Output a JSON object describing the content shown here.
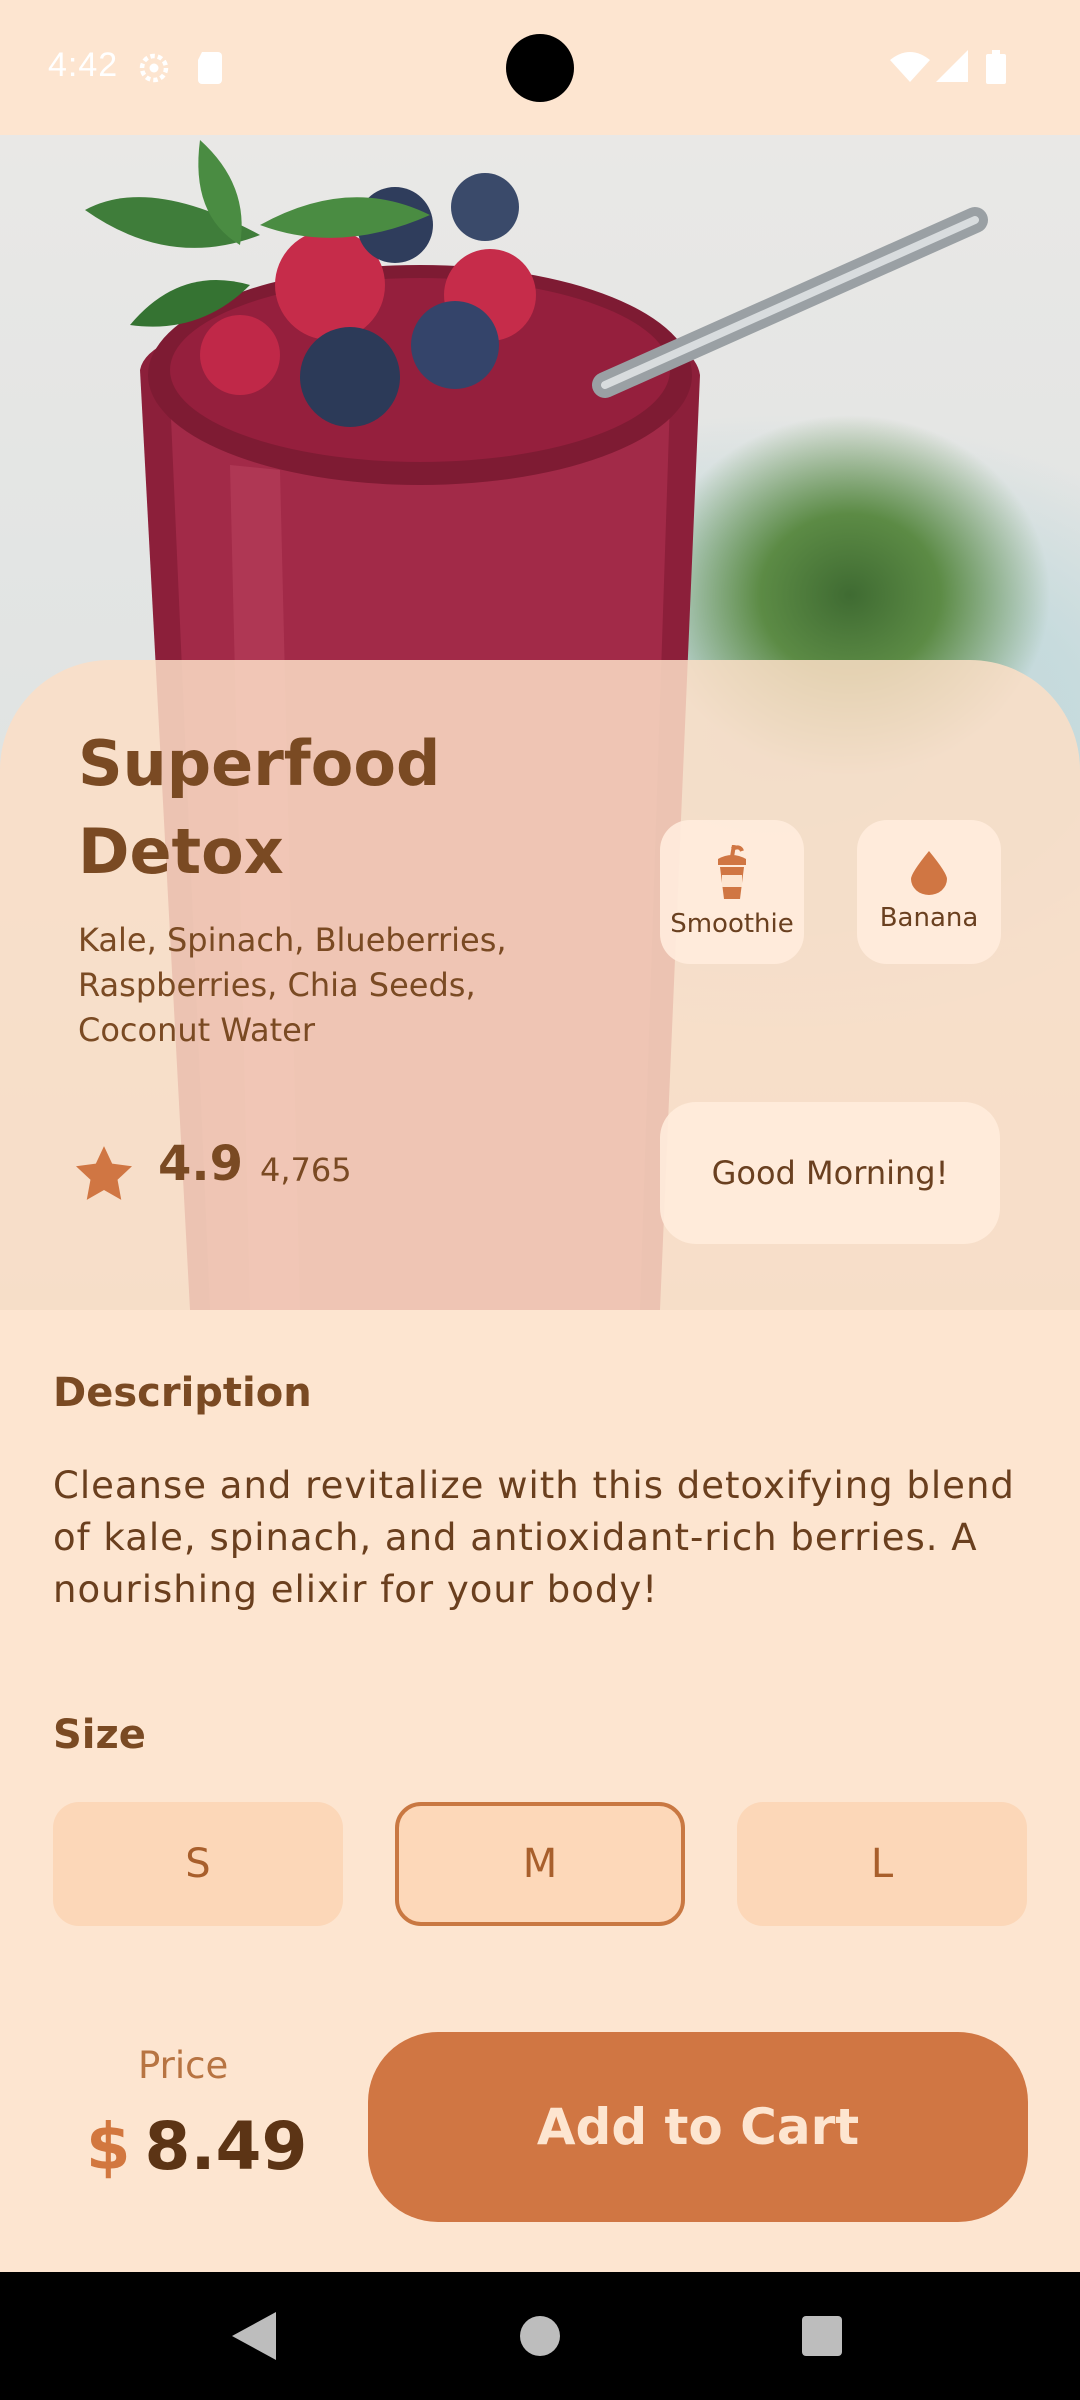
{
  "status_bar": {
    "time": "4:42"
  },
  "product": {
    "title": "Superfood Detox",
    "ingredients": "Kale, Spinach, Blueberries, Raspberries, Chia Seeds, Coconut Water",
    "tags": [
      {
        "label": "Smoothie",
        "icon": "smoothie-cup-icon"
      },
      {
        "label": "Banana",
        "icon": "drop-icon"
      }
    ],
    "rating": "4.9",
    "rating_count": "4,765",
    "greeting": "Good Morning!"
  },
  "description": {
    "heading": "Description",
    "text": "Cleanse and revitalize with this detoxifying blend of kale, spinach, and antioxidant-rich berries. A nourishing elixir for your body!"
  },
  "size": {
    "heading": "Size",
    "options": [
      "S",
      "M",
      "L"
    ],
    "selected": "M"
  },
  "price": {
    "label": "Price",
    "currency": "$",
    "value": "8.49"
  },
  "cart": {
    "label": "Add to Cart"
  },
  "colors": {
    "background": "#fde5d0",
    "accent": "#d07643",
    "text_dark": "#7a4a23"
  }
}
